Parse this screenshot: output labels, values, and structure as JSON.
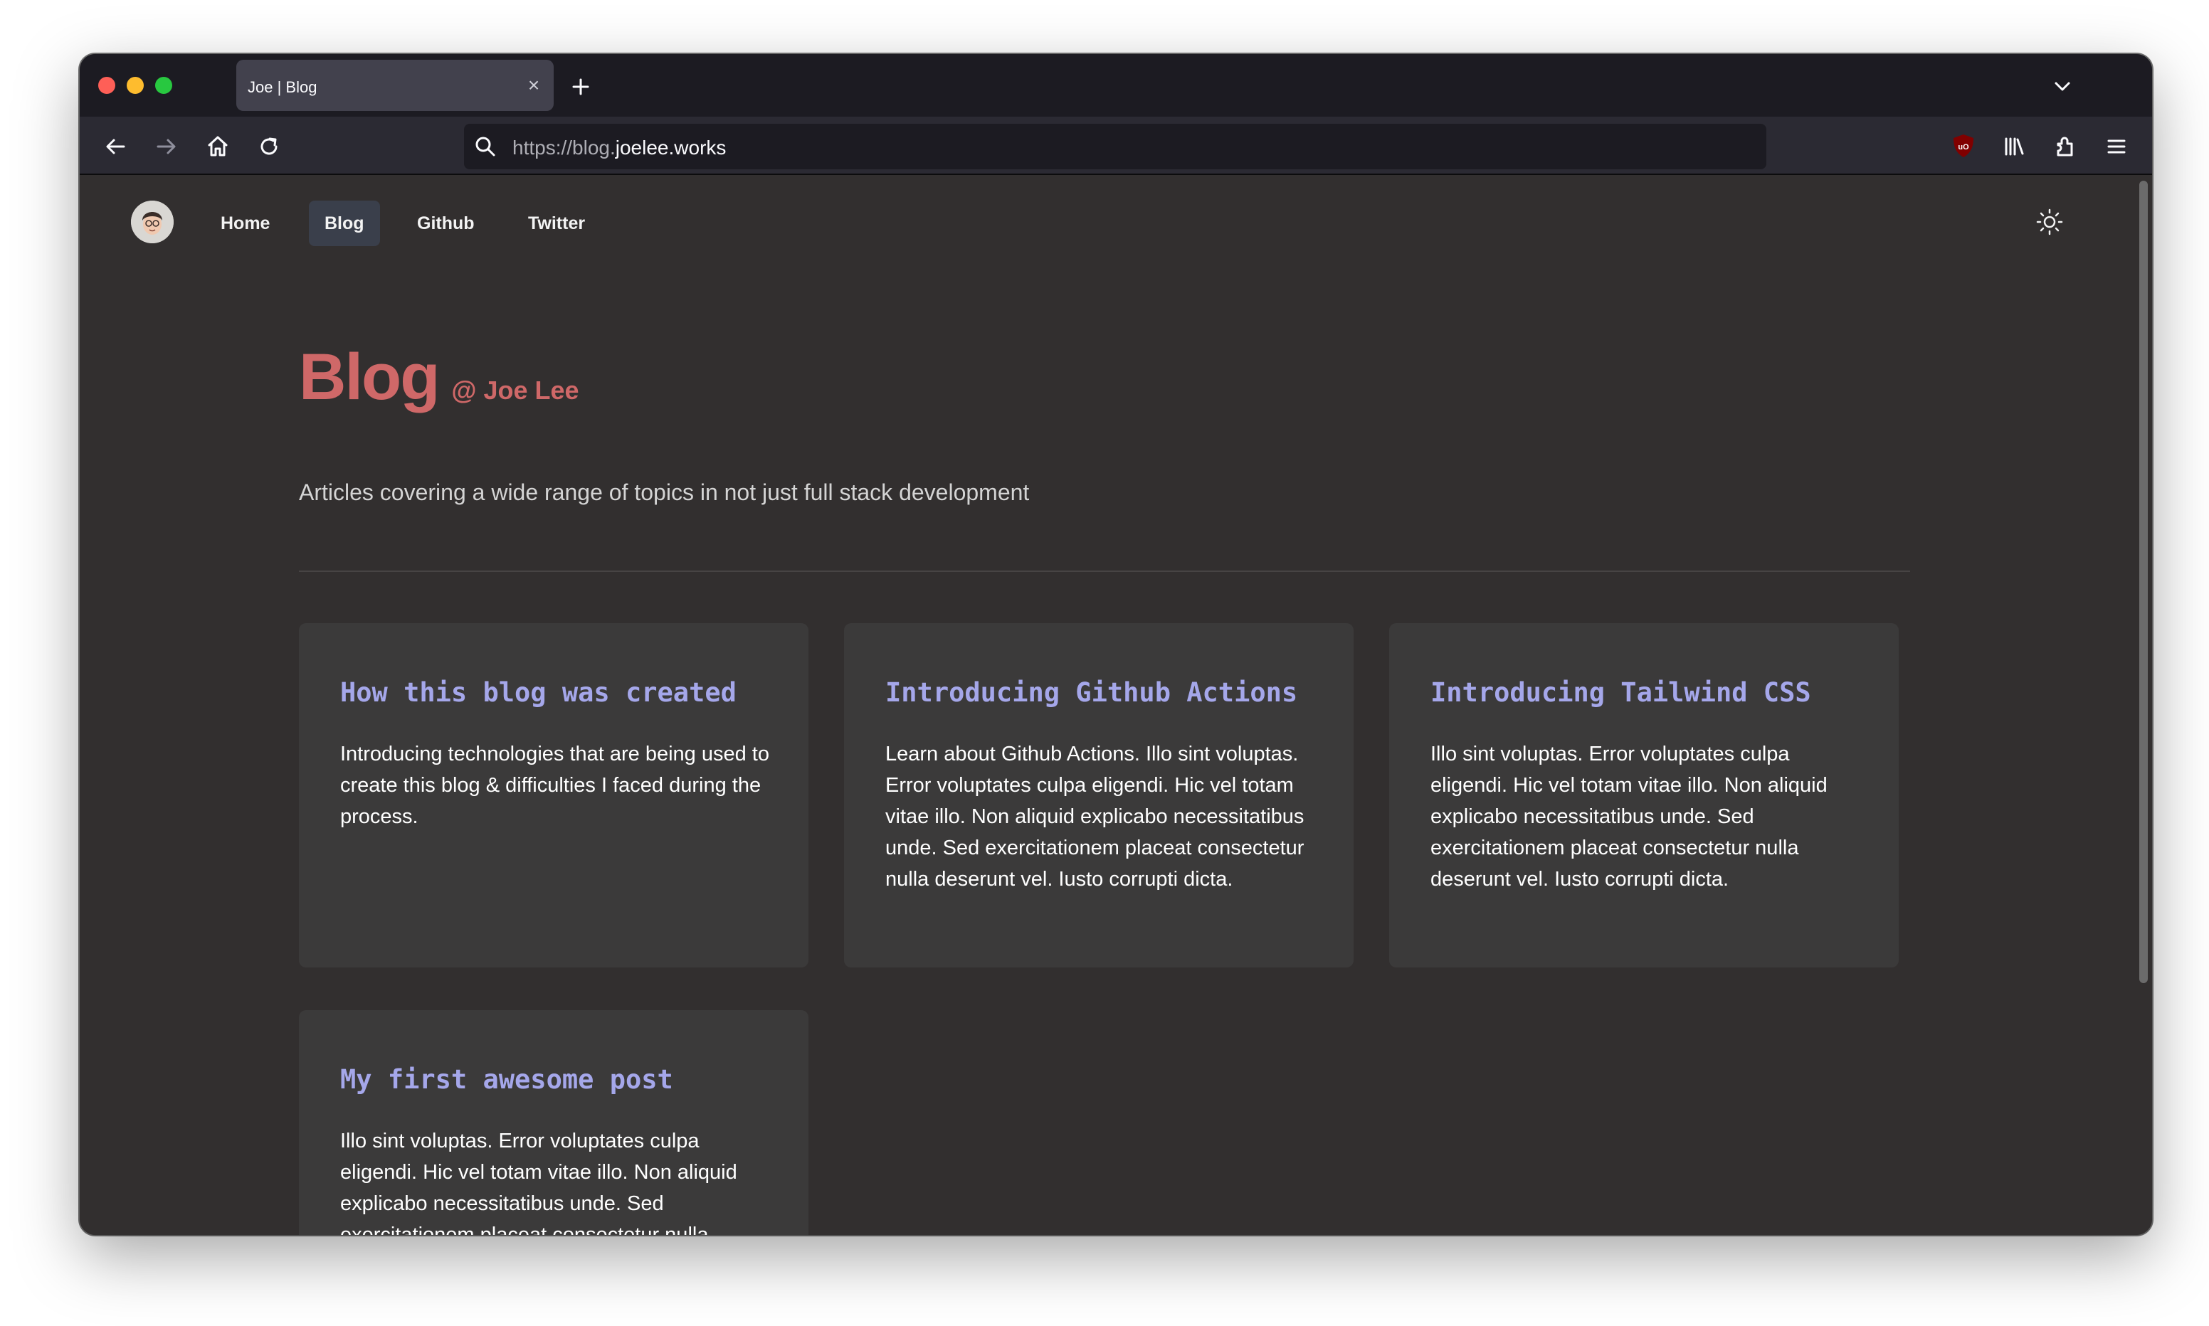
{
  "browser": {
    "tab_title": "Joe | Blog",
    "url_prefix": "https://blog.",
    "url_domain": "joelee.works",
    "extension_badge": "uO"
  },
  "site_nav": {
    "items": [
      {
        "label": "Home",
        "active": false
      },
      {
        "label": "Blog",
        "active": true
      },
      {
        "label": "Github",
        "active": false
      },
      {
        "label": "Twitter",
        "active": false
      }
    ]
  },
  "hero": {
    "title": "Blog",
    "author": "@ Joe Lee",
    "subtitle": "Articles covering a wide range of topics in not just full stack development"
  },
  "posts": [
    {
      "title": "How this blog was created",
      "summary": "Introducing technologies that are being used to create this blog & difficulties I faced during the process."
    },
    {
      "title": "Introducing Github Actions",
      "summary": "Learn about Github Actions. Illo sint voluptas. Error voluptates culpa eligendi. Hic vel totam vitae illo. Non aliquid explicabo necessitatibus unde. Sed exercitationem placeat consectetur nulla deserunt vel. Iusto corrupti dicta."
    },
    {
      "title": "Introducing Tailwind CSS",
      "summary": "Illo sint voluptas. Error voluptates culpa eligendi. Hic vel totam vitae illo. Non aliquid explicabo necessitatibus unde. Sed exercitationem placeat consectetur nulla deserunt vel. Iusto corrupti dicta."
    },
    {
      "title": "My first awesome post",
      "summary": "Illo sint voluptas. Error voluptates culpa eligendi. Hic vel totam vitae illo. Non aliquid explicabo necessitatibus unde. Sed exercitationem placeat consectetur nulla deserunt vel. Iusto corrupti dicta."
    }
  ],
  "colors": {
    "page_background": "#322f2f",
    "card_background": "#3b3a3a",
    "accent_heading": "#cf6868",
    "card_title": "#a5a7ea"
  }
}
